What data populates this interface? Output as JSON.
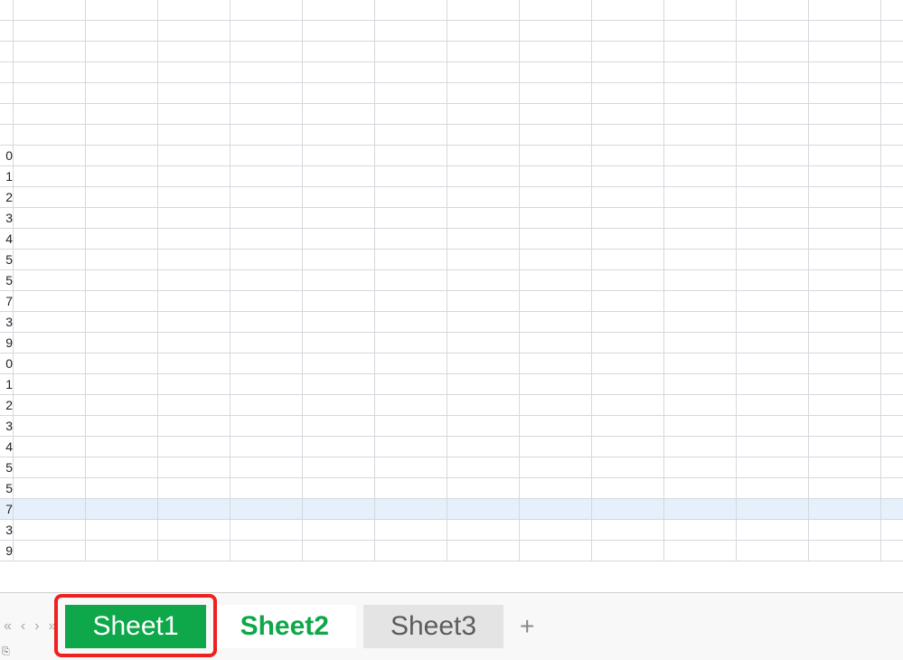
{
  "rows": [
    "",
    "",
    "",
    "",
    "",
    "",
    "",
    "0",
    "1",
    "2",
    "3",
    "4",
    "5",
    "5",
    "7",
    "3",
    "9",
    "0",
    "1",
    "2",
    "3",
    "4",
    "5",
    "5",
    "7",
    "3",
    "9"
  ],
  "selected_row_index": 24,
  "columns": 13,
  "nav": {
    "first": "«",
    "prev": "‹",
    "next": "›",
    "last": "»"
  },
  "tabs": [
    {
      "label": "Sheet1",
      "state": "active",
      "highlighted": true
    },
    {
      "label": "Sheet2",
      "state": "green",
      "highlighted": false
    },
    {
      "label": "Sheet3",
      "state": "grey",
      "highlighted": false
    }
  ],
  "add_label": "+"
}
